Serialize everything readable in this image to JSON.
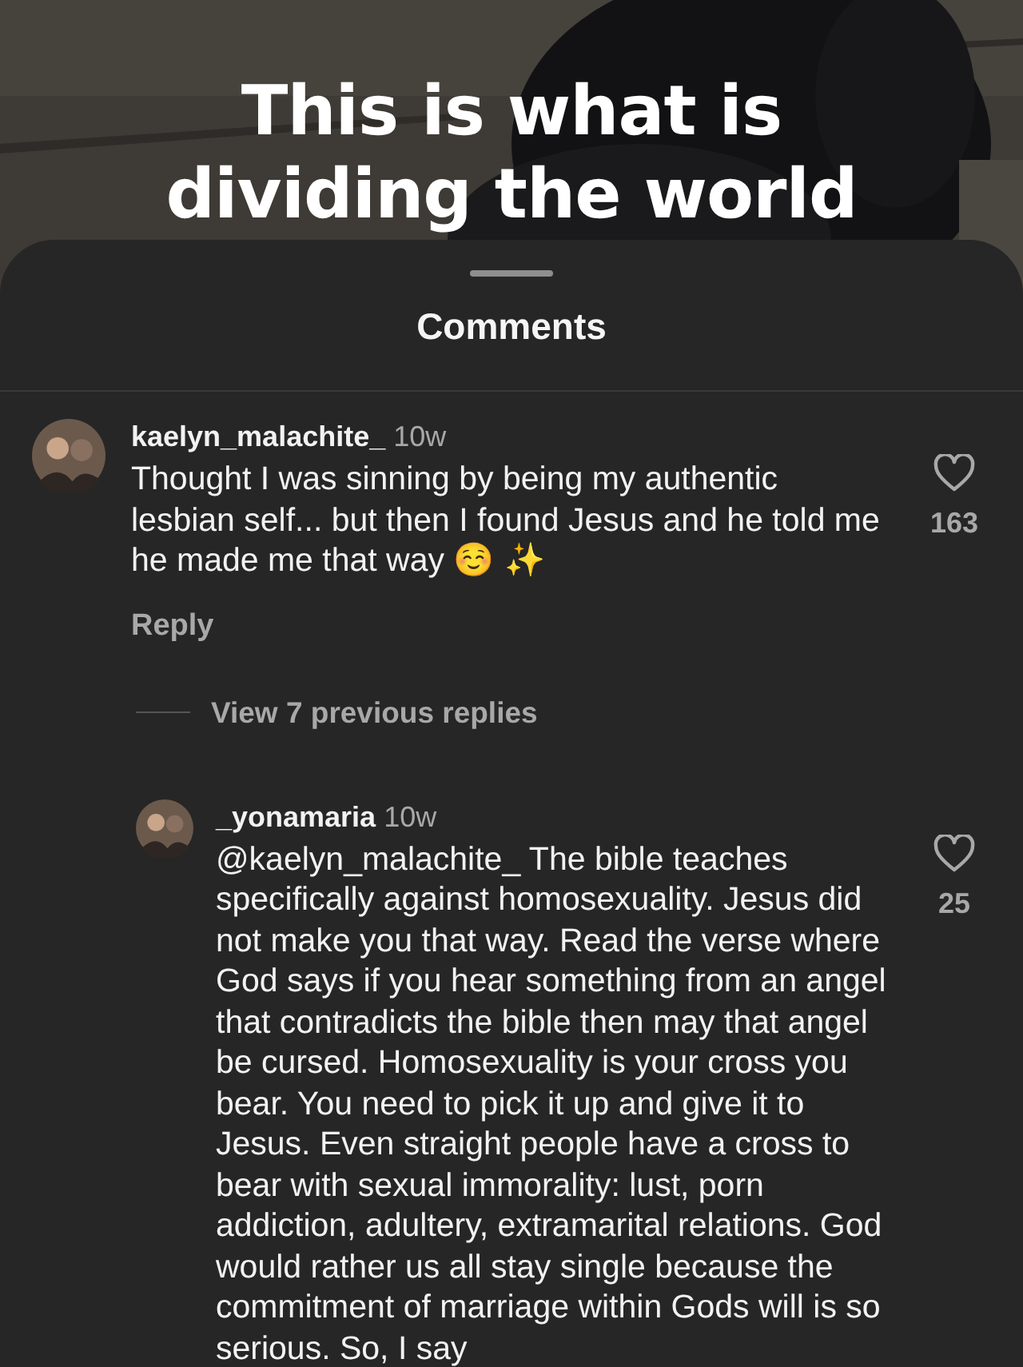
{
  "overlay_title": "This is what is dividing the world",
  "sheet": {
    "title": "Comments"
  },
  "comments": [
    {
      "username": "kaelyn_malachite_",
      "time": "10w",
      "text": "Thought I was sinning by being my authentic lesbian self... but then I found Jesus and he told me he made me that way ☺️ ✨",
      "liked": false,
      "likes": "163",
      "reply": "Reply",
      "replies_link": "View 7 previous replies",
      "replies": [
        {
          "username": "_yonamaria",
          "time": "10w",
          "text": "@kaelyn_malachite_ The bible teaches specifically against homosexuality. Jesus did not make you that way. Read the verse where God says if you hear something from an angel that contradicts the bible then may that angel be cursed. Homosexuality is your cross you bear. You need to pick it up and give it to Jesus. Even straight people have a cross to bear with sexual immorality: lust, porn addiction, adultery, extramarital relations. God would rather us all stay single because the commitment of marriage within Gods will is so serious. So, I say",
          "liked": false,
          "likes": "25"
        }
      ]
    }
  ]
}
